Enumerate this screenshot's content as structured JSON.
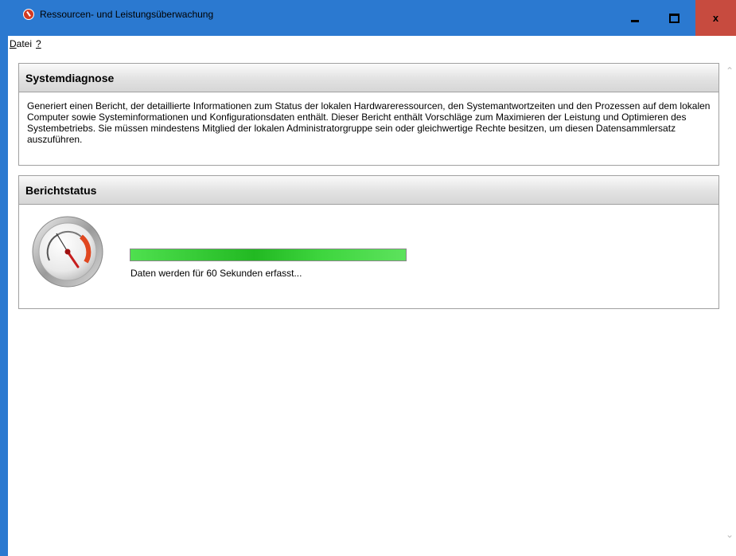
{
  "window": {
    "title": "Ressourcen- und Leistungsüberwachung",
    "close_label": "x"
  },
  "menu": [
    {
      "accel": "D",
      "rest": "atei"
    },
    {
      "accel": "?",
      "rest": ""
    }
  ],
  "diagnosis": {
    "header": "Systemdiagnose",
    "description": "Generiert einen Bericht, der detaillierte Informationen zum Status der lokalen Hardwareressourcen, den Systemantwortzeiten und den Prozessen auf dem lokalen Computer sowie Systeminformationen und Konfigurationsdaten enthält. Dieser Bericht enthält Vorschläge zum Maximieren der Leistung und Optimieren des Systembetriebs. Sie müssen mindestens Mitglied der lokalen Administratorgruppe sein oder gleichwertige Rechte besitzen, um diesen Datensammlersatz auszuführen."
  },
  "report_status": {
    "header": "Berichtstatus",
    "progress_fraction": 1.0,
    "status_text": "Daten werden für 60 Sekunden erfasst..."
  },
  "colors": {
    "titlebar": "#2b79d0",
    "close_button": "#c74b3f",
    "progress_green": "#22b922"
  },
  "icons": {
    "title": "performance-monitor-icon",
    "gauge": "gauge-icon"
  }
}
